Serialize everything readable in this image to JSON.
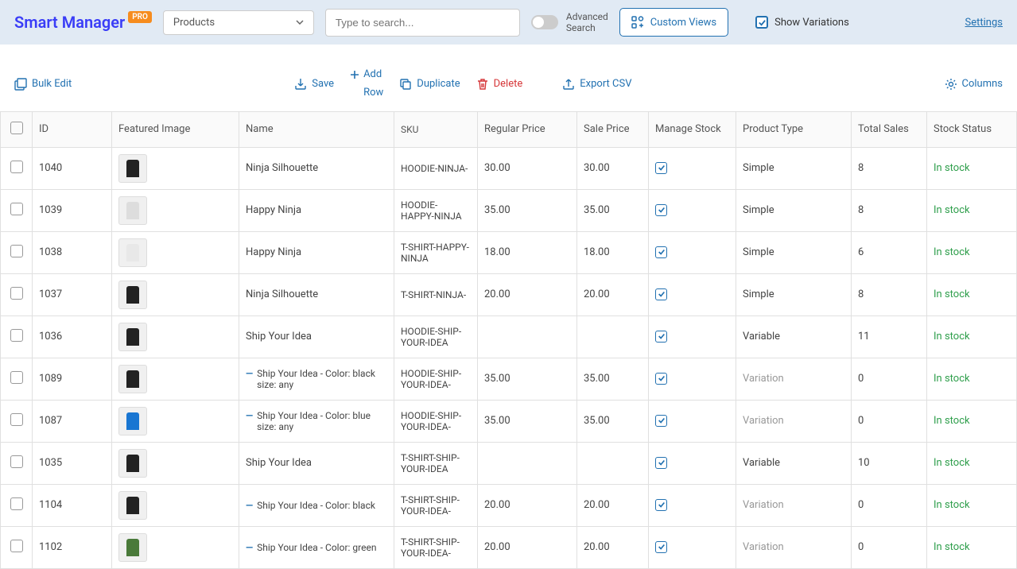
{
  "header": {
    "logo": "Smart Manager",
    "pro": "PRO",
    "dashboard_selected": "Products",
    "search_placeholder": "Type to search...",
    "advanced_search": "Advanced\nSearch",
    "custom_views": "Custom Views",
    "show_variations": "Show Variations",
    "settings": "Settings"
  },
  "toolbar": {
    "bulk_edit": "Bulk Edit",
    "save": "Save",
    "add": "Add",
    "row": "Row",
    "duplicate": "Duplicate",
    "delete": "Delete",
    "export_csv": "Export CSV",
    "columns": "Columns"
  },
  "columns": {
    "id": "ID",
    "featured_image": "Featured Image",
    "name": "Name",
    "sku": "SKU",
    "regular_price": "Regular Price",
    "sale_price": "Sale Price",
    "manage_stock": "Manage Stock",
    "product_type": "Product Type",
    "total_sales": "Total Sales",
    "stock_status": "Stock Status"
  },
  "rows": [
    {
      "id": "1040",
      "thumb": "#222",
      "name": "Ninja Silhouette",
      "is_var": false,
      "sku": "HOODIE-NINJA-",
      "reg": "30.00",
      "sale": "30.00",
      "manage": true,
      "type": "Simple",
      "sales": "8",
      "stock": "In stock"
    },
    {
      "id": "1039",
      "thumb": "#ddd",
      "name": "Happy Ninja",
      "is_var": false,
      "sku": "HOODIE-HAPPY-NINJA",
      "reg": "35.00",
      "sale": "35.00",
      "manage": true,
      "type": "Simple",
      "sales": "8",
      "stock": "In stock"
    },
    {
      "id": "1038",
      "thumb": "#e8e8e8",
      "name": "Happy Ninja",
      "is_var": false,
      "sku": "T-SHIRT-HAPPY-NINJA",
      "reg": "18.00",
      "sale": "18.00",
      "manage": true,
      "type": "Simple",
      "sales": "6",
      "stock": "In stock"
    },
    {
      "id": "1037",
      "thumb": "#222",
      "name": "Ninja Silhouette",
      "is_var": false,
      "sku": "T-SHIRT-NINJA-",
      "reg": "20.00",
      "sale": "20.00",
      "manage": true,
      "type": "Simple",
      "sales": "8",
      "stock": "In stock"
    },
    {
      "id": "1036",
      "thumb": "#222",
      "name": "Ship Your Idea",
      "is_var": false,
      "sku": "HOODIE-SHIP-YOUR-IDEA",
      "reg": "",
      "sale": "",
      "manage": true,
      "type": "Variable",
      "sales": "11",
      "stock": "In stock"
    },
    {
      "id": "1089",
      "thumb": "#222",
      "name": "Ship Your Idea - Color: black | size: any",
      "is_var": true,
      "sku": "HOODIE-SHIP-YOUR-IDEA-",
      "reg": "35.00",
      "sale": "35.00",
      "manage": true,
      "type": "Variation",
      "sales": "0",
      "stock": "In stock"
    },
    {
      "id": "1087",
      "thumb": "#1976d2",
      "name": "Ship Your Idea - Color: blue | size: any",
      "is_var": true,
      "sku": "HOODIE-SHIP-YOUR-IDEA-",
      "reg": "35.00",
      "sale": "35.00",
      "manage": true,
      "type": "Variation",
      "sales": "0",
      "stock": "In stock"
    },
    {
      "id": "1035",
      "thumb": "#222",
      "name": "Ship Your Idea",
      "is_var": false,
      "sku": "T-SHIRT-SHIP-YOUR-IDEA",
      "reg": "",
      "sale": "",
      "manage": true,
      "type": "Variable",
      "sales": "10",
      "stock": "In stock"
    },
    {
      "id": "1104",
      "thumb": "#222",
      "name": "Ship Your Idea - Color: black",
      "is_var": true,
      "sku": "T-SHIRT-SHIP-YOUR-IDEA-",
      "reg": "20.00",
      "sale": "20.00",
      "manage": true,
      "type": "Variation",
      "sales": "0",
      "stock": "In stock"
    },
    {
      "id": "1102",
      "thumb": "#4a7a3a",
      "name": "Ship Your Idea - Color: green",
      "is_var": true,
      "sku": "T-SHIRT-SHIP-YOUR-IDEA-",
      "reg": "20.00",
      "sale": "20.00",
      "manage": true,
      "type": "Variation",
      "sales": "0",
      "stock": "In stock"
    }
  ]
}
